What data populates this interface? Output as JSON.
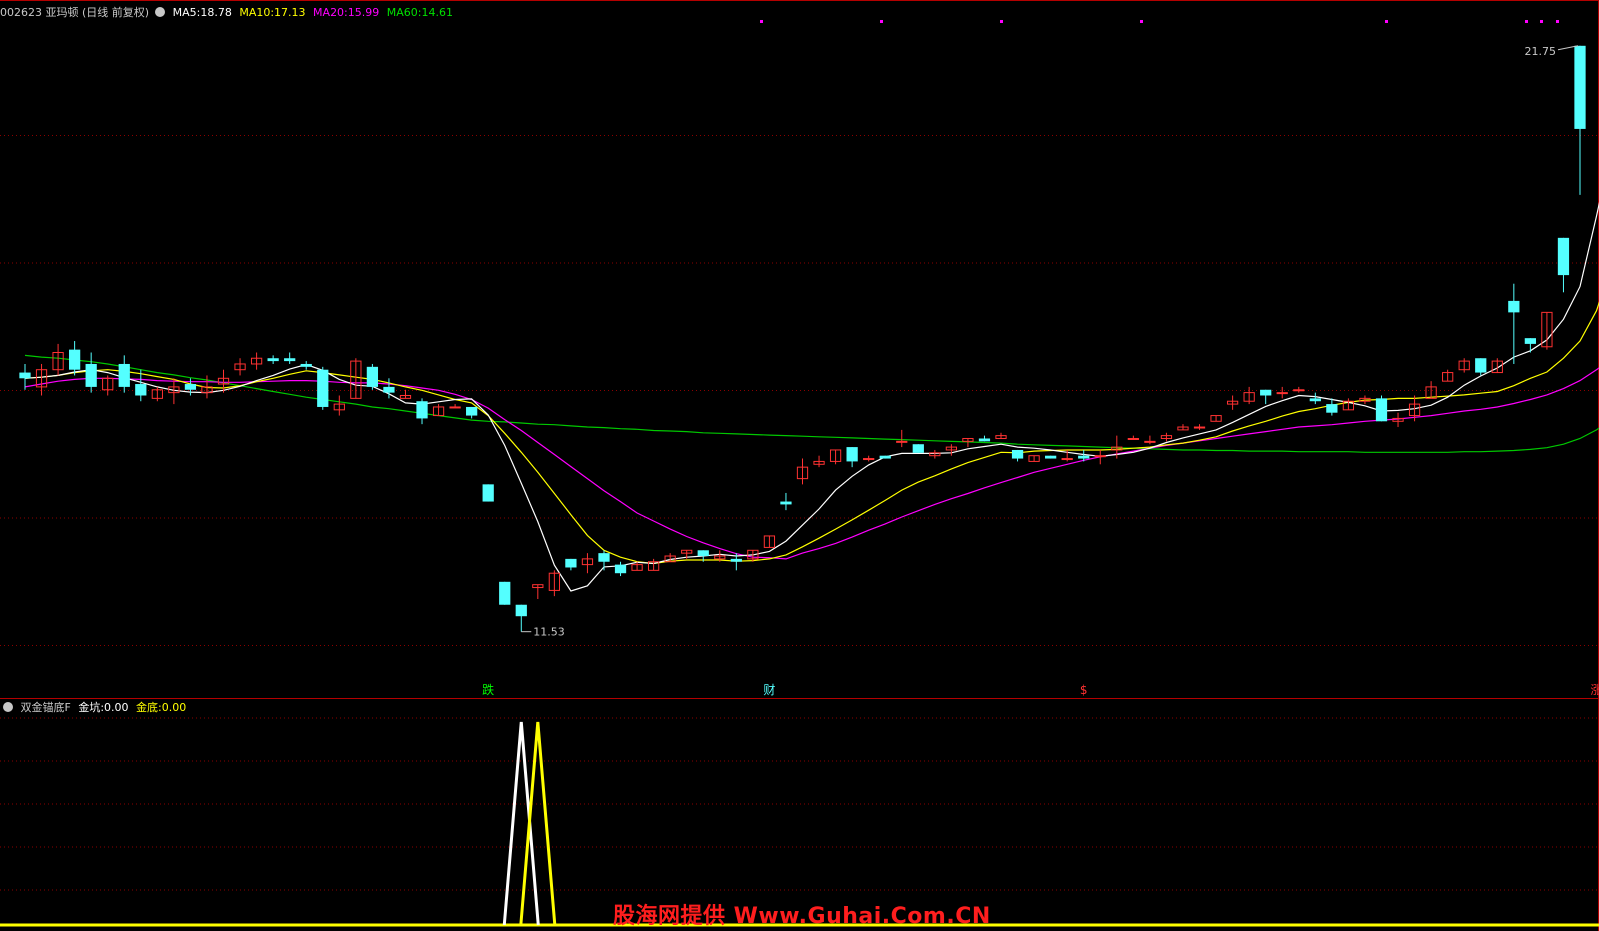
{
  "header": {
    "code": "002623",
    "name": "亚玛顿",
    "mode": "(日线 前复权)",
    "ma5_label": "MA5:",
    "ma5_value": "18.78",
    "ma10_label": "MA10:",
    "ma10_value": "17.13",
    "ma20_label": "MA20:",
    "ma20_value": "15.99",
    "ma60_label": "MA60:",
    "ma60_value": "14.61"
  },
  "indicator": {
    "name": "双金锚底F",
    "label1": "金坑:",
    "value1": "0.00",
    "label2": "金底:",
    "value2": "0.00"
  },
  "watermark": "股海网提供 Www.Guhai.Com.CN",
  "colors": {
    "background": "#000000",
    "up": "#ff3232",
    "down": "#54ffff",
    "ma5": "#ffffff",
    "ma10": "#ffff00",
    "ma20": "#ff00ff",
    "ma60": "#00c800",
    "grid": "#8b0000",
    "jinkeng": "#ffffff",
    "jindi": "#ffff00"
  },
  "chart_data": [
    {
      "type": "candlestick",
      "title": "002623 亚玛顿(日线 前复权)",
      "ylim": [
        10.6,
        22.2
      ],
      "max_label": "21.75",
      "min_label": "11.53",
      "event_labels": [
        "跌",
        "财",
        "$",
        "涨"
      ],
      "candles": [
        [
          16.05,
          16.2,
          15.75,
          15.95
        ],
        [
          15.8,
          16.2,
          15.65,
          16.1
        ],
        [
          16.1,
          16.55,
          16.0,
          16.4
        ],
        [
          16.45,
          16.6,
          16.0,
          16.1
        ],
        [
          16.2,
          16.4,
          15.7,
          15.8
        ],
        [
          15.75,
          16.0,
          15.65,
          15.95
        ],
        [
          16.2,
          16.35,
          15.7,
          15.8
        ],
        [
          15.85,
          16.1,
          15.55,
          15.65
        ],
        [
          15.6,
          15.8,
          15.55,
          15.75
        ],
        [
          15.7,
          15.95,
          15.5,
          15.8
        ],
        [
          15.85,
          15.95,
          15.65,
          15.75
        ],
        [
          15.7,
          16.0,
          15.6,
          15.8
        ],
        [
          15.85,
          16.1,
          15.7,
          15.95
        ],
        [
          16.1,
          16.3,
          16.0,
          16.2
        ],
        [
          16.2,
          16.4,
          16.1,
          16.3
        ],
        [
          16.3,
          16.35,
          16.2,
          16.25
        ],
        [
          16.3,
          16.4,
          16.2,
          16.25
        ],
        [
          16.2,
          16.25,
          16.1,
          16.15
        ],
        [
          16.1,
          16.15,
          15.4,
          15.45
        ],
        [
          15.4,
          15.65,
          15.3,
          15.5
        ],
        [
          15.6,
          16.3,
          15.6,
          16.25
        ],
        [
          16.15,
          16.2,
          15.75,
          15.8
        ],
        [
          15.8,
          15.95,
          15.6,
          15.7
        ],
        [
          15.6,
          15.75,
          15.6,
          15.65
        ],
        [
          15.55,
          15.6,
          15.15,
          15.25
        ],
        [
          15.3,
          15.5,
          15.3,
          15.45
        ],
        [
          15.45,
          15.5,
          15.45,
          15.45
        ],
        [
          15.45,
          15.4,
          15.25,
          15.3
        ],
        [
          14.1,
          14.1,
          13.8,
          13.8
        ],
        [
          12.4,
          12.4,
          12.0,
          12.0
        ],
        [
          12.0,
          12.0,
          11.53,
          11.8
        ],
        [
          12.3,
          12.3,
          12.1,
          12.35
        ],
        [
          12.25,
          12.6,
          12.15,
          12.55
        ],
        [
          12.8,
          12.8,
          12.6,
          12.65
        ],
        [
          12.7,
          12.9,
          12.55,
          12.8
        ],
        [
          12.9,
          12.95,
          12.6,
          12.75
        ],
        [
          12.7,
          12.75,
          12.5,
          12.55
        ],
        [
          12.6,
          12.75,
          12.6,
          12.7
        ],
        [
          12.6,
          12.8,
          12.65,
          12.75
        ],
        [
          12.75,
          12.9,
          12.75,
          12.85
        ],
        [
          12.9,
          12.95,
          12.8,
          12.95
        ],
        [
          12.95,
          12.85,
          12.75,
          12.85
        ],
        [
          12.8,
          12.95,
          12.75,
          12.85
        ],
        [
          12.8,
          12.9,
          12.6,
          12.75
        ],
        [
          12.8,
          12.95,
          12.75,
          12.95
        ],
        [
          13.0,
          13.0,
          13.25,
          13.2
        ],
        [
          13.8,
          13.95,
          13.65,
          13.75
        ],
        [
          14.2,
          14.55,
          14.1,
          14.4
        ],
        [
          14.45,
          14.6,
          14.4,
          14.5
        ],
        [
          14.5,
          14.7,
          14.45,
          14.7
        ],
        [
          14.75,
          14.7,
          14.4,
          14.5
        ],
        [
          14.55,
          14.6,
          14.5,
          14.55
        ],
        [
          14.6,
          14.6,
          14.55,
          14.55
        ],
        [
          14.85,
          15.05,
          14.75,
          14.85
        ],
        [
          14.8,
          14.8,
          14.65,
          14.65
        ],
        [
          14.6,
          14.7,
          14.55,
          14.65
        ],
        [
          14.7,
          14.8,
          14.6,
          14.75
        ],
        [
          14.85,
          14.9,
          14.75,
          14.9
        ],
        [
          14.9,
          14.95,
          14.85,
          14.85
        ],
        [
          14.9,
          15.0,
          14.9,
          14.95
        ],
        [
          14.7,
          14.7,
          14.5,
          14.55
        ],
        [
          14.5,
          14.6,
          14.5,
          14.6
        ],
        [
          14.6,
          14.6,
          14.6,
          14.55
        ],
        [
          14.55,
          14.7,
          14.5,
          14.55
        ],
        [
          14.6,
          14.7,
          14.5,
          14.55
        ],
        [
          14.6,
          14.7,
          14.45,
          14.6
        ],
        [
          14.7,
          14.95,
          14.55,
          14.75
        ],
        [
          14.9,
          14.95,
          14.9,
          14.9
        ],
        [
          14.85,
          14.95,
          14.8,
          14.85
        ],
        [
          14.9,
          15.0,
          14.85,
          14.95
        ],
        [
          15.05,
          15.15,
          15.05,
          15.1
        ],
        [
          15.1,
          15.15,
          15.05,
          15.1
        ],
        [
          15.2,
          15.3,
          15.2,
          15.3
        ],
        [
          15.5,
          15.65,
          15.4,
          15.55
        ],
        [
          15.55,
          15.8,
          15.5,
          15.7
        ],
        [
          15.75,
          15.75,
          15.5,
          15.65
        ],
        [
          15.7,
          15.8,
          15.6,
          15.7
        ],
        [
          15.75,
          15.8,
          15.7,
          15.75
        ],
        [
          15.6,
          15.7,
          15.5,
          15.55
        ],
        [
          15.5,
          15.6,
          15.3,
          15.35
        ],
        [
          15.4,
          15.6,
          15.4,
          15.55
        ],
        [
          15.55,
          15.65,
          15.5,
          15.6
        ],
        [
          15.6,
          15.65,
          15.2,
          15.2
        ],
        [
          15.2,
          15.35,
          15.1,
          15.25
        ],
        [
          15.3,
          15.65,
          15.2,
          15.5
        ],
        [
          15.6,
          15.9,
          15.6,
          15.8
        ],
        [
          15.9,
          16.1,
          15.9,
          16.05
        ],
        [
          16.1,
          16.3,
          16.05,
          16.25
        ],
        [
          16.3,
          16.25,
          16.0,
          16.05
        ],
        [
          16.05,
          16.3,
          16.05,
          16.25
        ],
        [
          17.3,
          17.6,
          16.2,
          17.1
        ],
        [
          16.65,
          16.5,
          16.4,
          16.55
        ],
        [
          16.5,
          16.85,
          16.45,
          17.1
        ],
        [
          18.4,
          18.4,
          17.45,
          17.75
        ],
        [
          21.75,
          21.75,
          19.15,
          20.3
        ]
      ],
      "ma60": [
        16.35,
        16.32,
        16.3,
        16.27,
        16.24,
        16.2,
        16.15,
        16.1,
        16.05,
        16.01,
        15.96,
        15.92,
        15.87,
        15.82,
        15.77,
        15.72,
        15.67,
        15.62,
        15.58,
        15.54,
        15.5,
        15.45,
        15.42,
        15.38,
        15.34,
        15.3,
        15.26,
        15.22,
        15.2,
        15.19,
        15.17,
        15.15,
        15.14,
        15.12,
        15.1,
        15.09,
        15.07,
        15.06,
        15.04,
        15.03,
        15.02,
        15.0,
        14.99,
        14.98,
        14.97,
        14.96,
        14.95,
        14.94,
        14.93,
        14.92,
        14.91,
        14.9,
        14.89,
        14.88,
        14.87,
        14.86,
        14.85,
        14.84,
        14.83,
        14.82,
        14.8,
        14.79,
        14.78,
        14.77,
        14.76,
        14.75,
        14.74,
        14.73,
        14.72,
        14.71,
        14.7,
        14.7,
        14.69,
        14.69,
        14.68,
        14.68,
        14.68,
        14.67,
        14.67,
        14.67,
        14.67,
        14.66,
        14.66,
        14.66,
        14.66,
        14.66,
        14.66,
        14.67,
        14.67,
        14.68,
        14.69,
        14.71,
        14.74,
        14.8,
        14.9,
        15.05,
        15.25
      ],
      "ma20": [
        15.8,
        15.85,
        15.9,
        15.93,
        15.95,
        15.95,
        15.94,
        15.93,
        15.91,
        15.9,
        15.89,
        15.89,
        15.88,
        15.88,
        15.89,
        15.9,
        15.91,
        15.91,
        15.9,
        15.88,
        15.87,
        15.87,
        15.85,
        15.82,
        15.78,
        15.74,
        15.67,
        15.58,
        15.43,
        15.23,
        15.04,
        14.83,
        14.62,
        14.41,
        14.2,
        13.99,
        13.8,
        13.6,
        13.46,
        13.32,
        13.19,
        13.08,
        12.98,
        12.89,
        12.83,
        12.82,
        12.8,
        12.9,
        12.98,
        13.07,
        13.18,
        13.3,
        13.41,
        13.53,
        13.64,
        13.75,
        13.85,
        13.94,
        14.04,
        14.13,
        14.22,
        14.31,
        14.38,
        14.45,
        14.52,
        14.58,
        14.63,
        14.68,
        14.73,
        14.78,
        14.82,
        14.86,
        14.9,
        14.94,
        14.98,
        15.02,
        15.06,
        15.1,
        15.12,
        15.14,
        15.17,
        15.2,
        15.22,
        15.24,
        15.27,
        15.3,
        15.34,
        15.38,
        15.41,
        15.45,
        15.51,
        15.58,
        15.66,
        15.77,
        15.91,
        16.1,
        16.3
      ],
      "ma10": [
        15.95,
        15.97,
        16.0,
        16.05,
        16.08,
        16.1,
        16.07,
        16.03,
        15.98,
        15.93,
        15.85,
        15.79,
        15.78,
        15.82,
        15.89,
        15.95,
        16.02,
        16.08,
        16.05,
        16.01,
        15.97,
        15.93,
        15.87,
        15.8,
        15.74,
        15.66,
        15.58,
        15.52,
        15.3,
        14.99,
        14.66,
        14.31,
        13.94,
        13.57,
        13.21,
        12.95,
        12.83,
        12.75,
        12.72,
        12.76,
        12.78,
        12.78,
        12.78,
        12.76,
        12.77,
        12.8,
        12.87,
        13.01,
        13.16,
        13.32,
        13.48,
        13.65,
        13.82,
        14.0,
        14.14,
        14.25,
        14.37,
        14.48,
        14.57,
        14.66,
        14.65,
        14.68,
        14.69,
        14.7,
        14.7,
        14.7,
        14.71,
        14.73,
        14.75,
        14.79,
        14.82,
        14.87,
        14.93,
        15.03,
        15.12,
        15.2,
        15.29,
        15.37,
        15.42,
        15.48,
        15.53,
        15.57,
        15.58,
        15.6,
        15.6,
        15.62,
        15.64,
        15.66,
        15.69,
        15.72,
        15.82,
        15.95,
        16.06,
        16.3,
        16.6,
        17.13,
        18.0
      ],
      "ma5": [
        15.95,
        15.97,
        16.0,
        16.06,
        16.1,
        16.05,
        15.96,
        15.88,
        15.8,
        15.74,
        15.71,
        15.7,
        15.74,
        15.81,
        15.91,
        16.0,
        16.11,
        16.19,
        16.09,
        15.93,
        15.83,
        15.81,
        15.68,
        15.52,
        15.5,
        15.54,
        15.58,
        15.59,
        15.31,
        14.78,
        14.12,
        13.45,
        12.69,
        12.24,
        12.33,
        12.66,
        12.68,
        12.74,
        12.72,
        12.79,
        12.83,
        12.85,
        12.88,
        12.85,
        12.87,
        12.93,
        13.11,
        13.39,
        13.67,
        14.0,
        14.24,
        14.44,
        14.58,
        14.64,
        14.64,
        14.64,
        14.65,
        14.72,
        14.76,
        14.8,
        14.75,
        14.73,
        14.7,
        14.66,
        14.62,
        14.59,
        14.62,
        14.66,
        14.73,
        14.83,
        14.91,
        14.98,
        15.05,
        15.18,
        15.32,
        15.46,
        15.56,
        15.65,
        15.63,
        15.58,
        15.53,
        15.47,
        15.38,
        15.39,
        15.42,
        15.48,
        15.62,
        15.83,
        15.99,
        16.13,
        16.32,
        16.43,
        16.62,
        16.98,
        17.55,
        18.78,
        20.1
      ],
      "jinkeng_spike_index": 30,
      "jindi_spike_index": 31
    }
  ]
}
